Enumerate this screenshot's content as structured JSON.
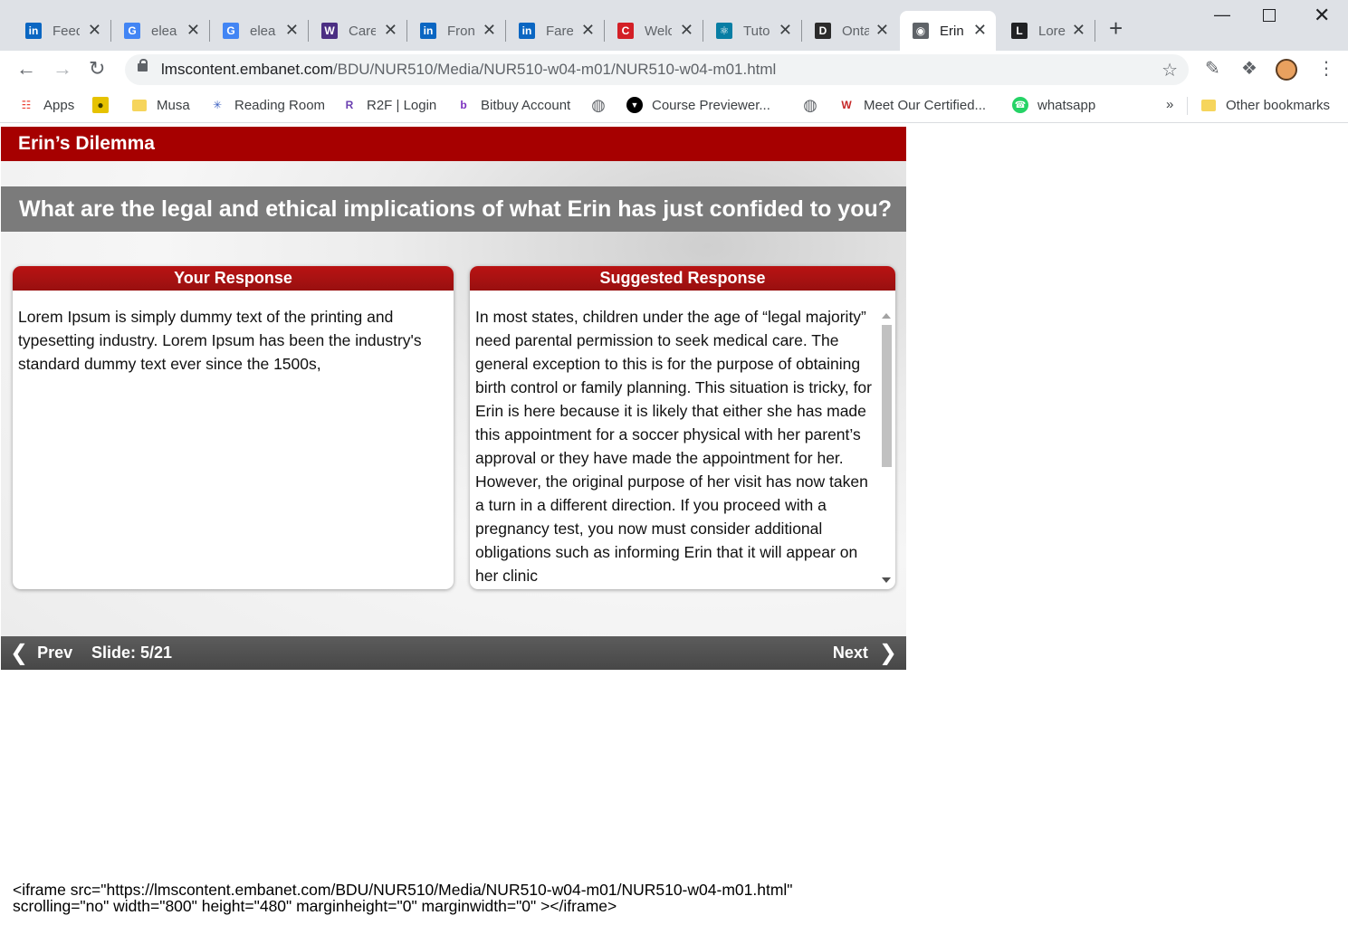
{
  "browser": {
    "tabs": [
      {
        "label": "Feed",
        "icon": "linkedin-icon",
        "color": "#0a66c2",
        "glyph": "in"
      },
      {
        "label": "elea",
        "icon": "google-icon",
        "color": "#4285f4",
        "glyph": "G"
      },
      {
        "label": "elea",
        "icon": "google-icon",
        "color": "#4285f4",
        "glyph": "G"
      },
      {
        "label": "Care",
        "icon": "crest-icon",
        "color": "#4b2e83",
        "glyph": "W"
      },
      {
        "label": "Fron",
        "icon": "linkedin-icon",
        "color": "#0a66c2",
        "glyph": "in"
      },
      {
        "label": "Fare",
        "icon": "linkedin-icon",
        "color": "#0a66c2",
        "glyph": "in"
      },
      {
        "label": "Welc",
        "icon": "c-logo-icon",
        "color": "#d31f26",
        "glyph": "C"
      },
      {
        "label": "Tuto",
        "icon": "react-icon",
        "color": "#087ea4",
        "glyph": "⚛"
      },
      {
        "label": "Onta",
        "icon": "dms-icon",
        "color": "#2b2b2b",
        "glyph": "D"
      },
      {
        "label": "Erin",
        "icon": "globe-icon",
        "color": "#5f6368",
        "glyph": "◉",
        "active": true
      },
      {
        "label": "Lore",
        "icon": "l-logo-icon",
        "color": "#202124",
        "glyph": "L"
      }
    ],
    "url_host": "lmscontent.embanet.com",
    "url_path": "/BDU/NUR510/Media/NUR510-w04-m01/NUR510-w04-m01.html",
    "bookmarks": [
      {
        "label": "Apps",
        "icon": "apps-grid-icon"
      },
      {
        "label": "",
        "icon": "badge-icon"
      },
      {
        "label": "Musa",
        "icon": "folder-icon"
      },
      {
        "label": "Reading Room",
        "icon": "reading-room-icon"
      },
      {
        "label": "R2F | Login",
        "icon": "r2f-icon"
      },
      {
        "label": "Bitbuy Account",
        "icon": "bitbuy-icon"
      },
      {
        "label": "",
        "icon": "globe-icon"
      },
      {
        "label": "Course Previewer...",
        "icon": "course-previewer-icon"
      },
      {
        "label": "",
        "icon": "globe-icon"
      },
      {
        "label": "Meet Our Certified...",
        "icon": "certified-icon"
      },
      {
        "label": "whatsapp",
        "icon": "whatsapp-icon"
      }
    ],
    "more_bookmarks": "»",
    "other_bookmarks": "Other bookmarks"
  },
  "course": {
    "title": "Erin’s Dilemma",
    "question": "What are the legal and ethical implications of what Erin has just confided to you?",
    "your_response": {
      "heading": "Your Response",
      "text": "Lorem Ipsum is simply dummy text of the printing and typesetting industry. Lorem Ipsum has been the industry's standard dummy text ever since the 1500s,"
    },
    "suggested_response": {
      "heading": "Suggested Response",
      "text": "In most states, children under the age of “legal majority” need parental permission to seek medical care. The general exception to this is for the purpose of obtaining birth control or family planning. This situation is tricky, for Erin is here because it is likely that either she has made this appointment for a soccer physical with her parent’s approval or they have made the appointment for her. However, the original purpose of her visit has now taken a turn in a different direction. If you proceed with a pregnancy test, you now must consider additional obligations such as informing Erin that it will appear on her clinic"
    },
    "nav": {
      "prev": "Prev",
      "next": "Next",
      "slide_label": "Slide:",
      "slide_current": 5,
      "slide_total": 21,
      "slide_text": "5/21"
    }
  },
  "embed_snippet": "<iframe src=\"https://lmscontent.embanet.com/BDU/NUR510/Media/NUR510-w04-m01/NUR510-w04-m01.html\"\nscrolling=\"no\" width=\"800\" height=\"480\" marginheight=\"0\" marginwidth=\"0\" ></iframe>",
  "colors": {
    "title_bar": "#a60000",
    "question_bar": "#7b7b7b",
    "panel_header": "#a81111",
    "nav_bar": "#505050"
  }
}
